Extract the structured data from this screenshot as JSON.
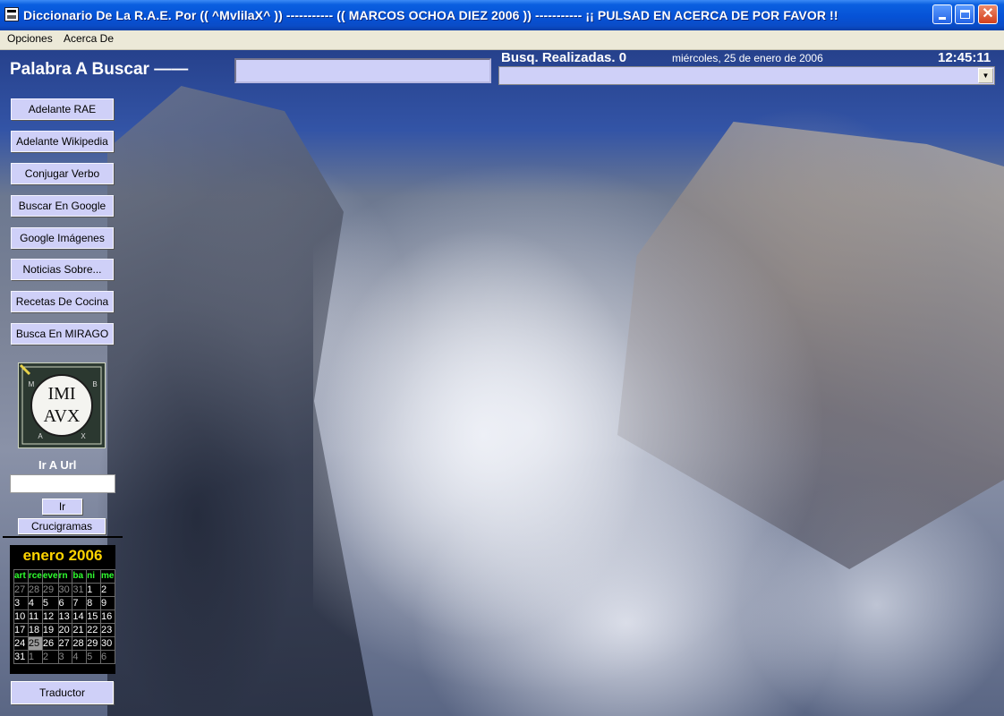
{
  "window": {
    "title": "Diccionario De La R.A.E. Por (( ^MvlilaX^ )) ----------- (( MARCOS OCHOA DIEZ 2006 )) ----------- ¡¡ PULSAD EN ACERCA DE POR FAVOR !!"
  },
  "menu": {
    "items": [
      {
        "label": "Opciones"
      },
      {
        "label": "Acerca De"
      }
    ]
  },
  "search": {
    "label": "Palabra A Buscar ——",
    "value": ""
  },
  "status": {
    "busquedas": "Busq. Realizadas. 0",
    "date": "miércoles, 25 de enero de 2006",
    "time": "12:45:11",
    "combo_value": ""
  },
  "sidebar": {
    "buttons": [
      {
        "label": "Adelante RAE"
      },
      {
        "label": "Adelante Wikipedia"
      },
      {
        "label": "Conjugar Verbo"
      },
      {
        "label": "Buscar En Google"
      },
      {
        "label": "Google Imágenes"
      },
      {
        "label": "Noticias Sobre..."
      },
      {
        "label": "Recetas De Cocina"
      },
      {
        "label": "Busca En MIRAGO"
      }
    ],
    "logo_text": {
      "top": "IMI",
      "bottom": "AVX",
      "corner_tl": "M",
      "corner_tr": "B",
      "corner_bl": "A",
      "corner_br": "X"
    },
    "url_label": "Ir A Url",
    "url_value": "",
    "ir_button": "Ir",
    "crucigramas_button": "Crucigramas",
    "traductor_button": "Traductor"
  },
  "calendar": {
    "title": "enero 2006",
    "weekdays": [
      "art",
      "rce",
      "eve",
      "rn",
      "ba",
      "ni",
      "me"
    ],
    "weeks": [
      [
        "27",
        "28",
        "29",
        "30",
        "31",
        "1",
        "2"
      ],
      [
        "3",
        "4",
        "5",
        "6",
        "7",
        "8",
        "9"
      ],
      [
        "10",
        "11",
        "12",
        "13",
        "14",
        "15",
        "16"
      ],
      [
        "17",
        "18",
        "19",
        "20",
        "21",
        "22",
        "23"
      ],
      [
        "24",
        "25",
        "26",
        "27",
        "28",
        "29",
        "30"
      ],
      [
        "31",
        "1",
        "2",
        "3",
        "4",
        "5",
        "6"
      ]
    ],
    "selected_day": "25"
  },
  "colors": {
    "titlebar": "#0652d6",
    "button_bg": "#cfd0f8",
    "calendar_title": "#ffd400",
    "calendar_weekday": "#30ff30"
  }
}
